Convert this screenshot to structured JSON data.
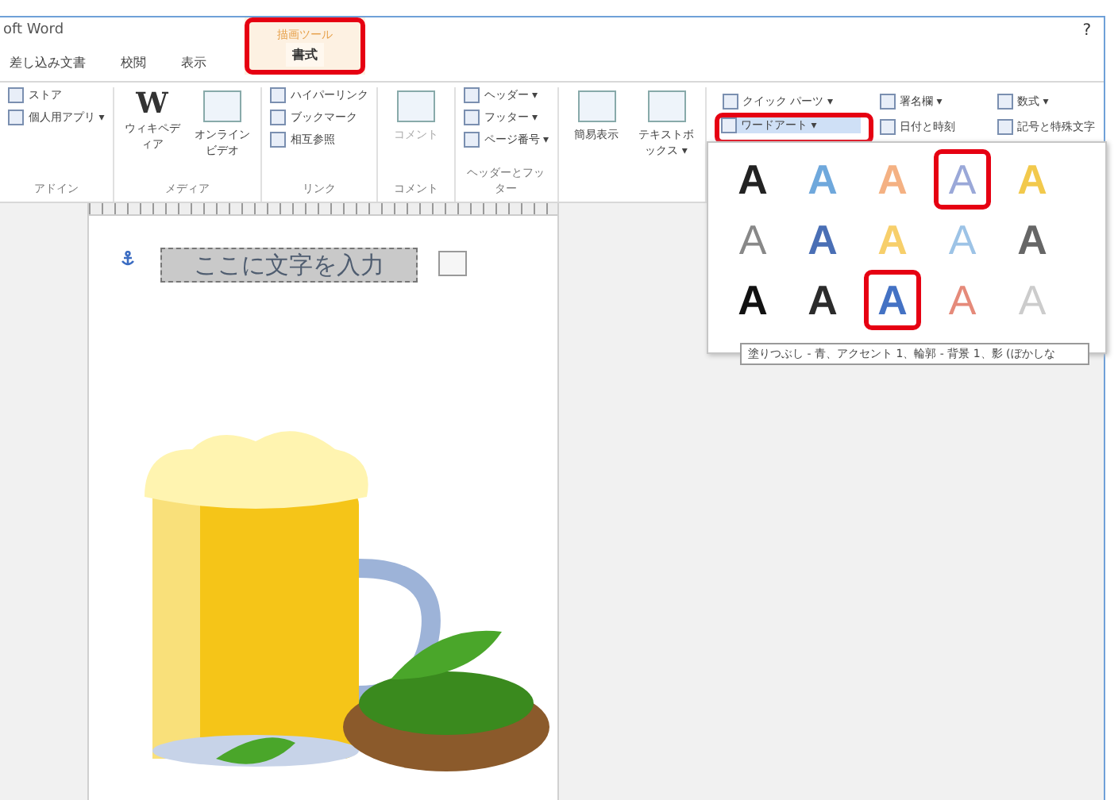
{
  "window": {
    "title": "oft Word",
    "help": "?"
  },
  "tabs": [
    {
      "label": "差し込み文書",
      "selected": false,
      "annotated": false
    },
    {
      "label": "校閲",
      "selected": false,
      "annotated": false
    },
    {
      "label": "表示",
      "selected": false,
      "annotated": false
    },
    {
      "context": "描画ツール",
      "label": "書式",
      "selected": true,
      "annotated": true
    }
  ],
  "ribbon": {
    "groups": [
      {
        "label": "アドイン",
        "items": [
          {
            "kind": "small",
            "label": "ストア"
          },
          {
            "kind": "small",
            "label": "個人用アプリ ▾"
          }
        ]
      },
      {
        "label": "メディア",
        "items": [
          {
            "kind": "large",
            "glyph": "W",
            "label": "ウィキペディア"
          },
          {
            "kind": "large",
            "label": "オンラインビデオ"
          }
        ]
      },
      {
        "label": "リンク",
        "items": [
          {
            "kind": "small",
            "label": "ハイパーリンク"
          },
          {
            "kind": "small",
            "label": "ブックマーク"
          },
          {
            "kind": "small",
            "label": "相互参照"
          }
        ]
      },
      {
        "label": "コメント",
        "items": [
          {
            "kind": "large",
            "label": "コメント",
            "disabled": true
          }
        ]
      },
      {
        "label": "ヘッダーとフッター",
        "items": [
          {
            "kind": "small",
            "label": "ヘッダー ▾"
          },
          {
            "kind": "small",
            "label": "フッター ▾"
          },
          {
            "kind": "small",
            "label": "ページ番号 ▾"
          }
        ]
      },
      {
        "items": [
          {
            "kind": "large",
            "label": "簡易表示"
          },
          {
            "kind": "large",
            "label": "テキストボックス ▾"
          }
        ]
      }
    ],
    "text_group": [
      {
        "label": "クイック パーツ ▾",
        "annotated": false
      },
      {
        "label": "署名欄 ▾",
        "annotated": false
      },
      {
        "label": "数式 ▾",
        "annotated": false
      },
      {
        "label": "ワードアート ▾",
        "annotated": true
      },
      {
        "label": "日付と時刻",
        "annotated": false
      },
      {
        "label": "記号と特殊文字",
        "annotated": false
      }
    ]
  },
  "wordart_gallery": {
    "items": [
      {
        "glyph": "A",
        "kind": "solid",
        "color": "#222222",
        "annotated": false
      },
      {
        "glyph": "A",
        "kind": "solid",
        "color": "#6fa8dc",
        "annotated": false
      },
      {
        "glyph": "A",
        "kind": "solid",
        "color": "#f4b183",
        "annotated": false
      },
      {
        "glyph": "A",
        "kind": "outline",
        "color": "#9aa8d8",
        "annotated": true
      },
      {
        "glyph": "A",
        "kind": "solid",
        "color": "#f2c94c",
        "annotated": false
      },
      {
        "glyph": "A",
        "kind": "outline",
        "color": "#888888",
        "annotated": false
      },
      {
        "glyph": "A",
        "kind": "solid",
        "color": "#4a6fb5",
        "annotated": false
      },
      {
        "glyph": "A",
        "kind": "solid",
        "color": "#f7cf6b",
        "annotated": false
      },
      {
        "glyph": "A",
        "kind": "outline",
        "color": "#9dc3e6",
        "annotated": false
      },
      {
        "glyph": "A",
        "kind": "solid",
        "color": "#666666",
        "annotated": false
      },
      {
        "glyph": "A",
        "kind": "solid",
        "color": "#111111",
        "annotated": false
      },
      {
        "glyph": "A",
        "kind": "solid",
        "color": "#2b2b2b",
        "annotated": false
      },
      {
        "glyph": "A",
        "kind": "solid",
        "color": "#4472c4",
        "annotated": true
      },
      {
        "glyph": "A",
        "kind": "outline",
        "color": "#e58a7a",
        "annotated": false
      },
      {
        "glyph": "A",
        "kind": "outline",
        "color": "#cccccc",
        "annotated": false
      }
    ],
    "tooltip": "塗りつぶし - 青、アクセント 1、輪郭 - 背景 1、影 (ぼかしな"
  },
  "document": {
    "textbox": "ここに文字を入力",
    "textbox_selected": true
  }
}
